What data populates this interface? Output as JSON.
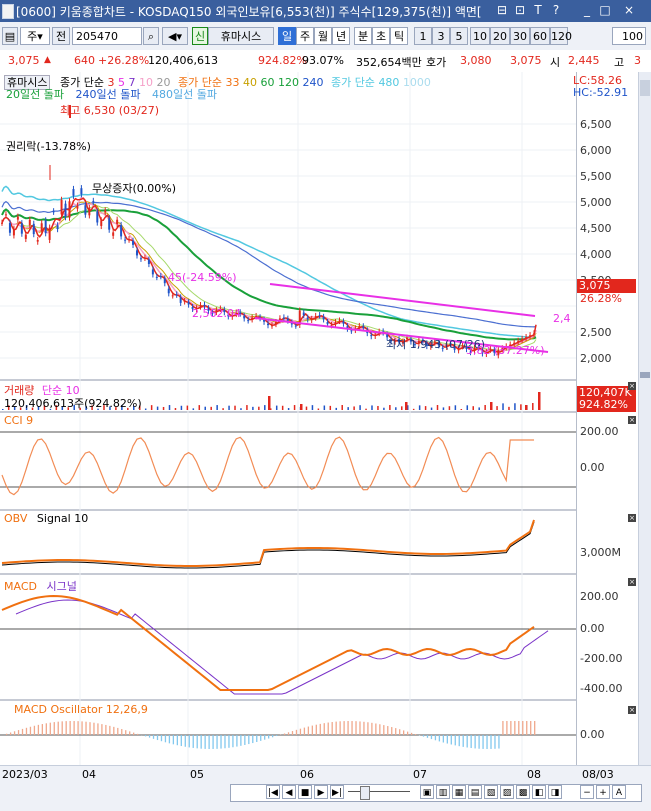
{
  "window": {
    "title": "[0600] 키움종합차트 - KOSDAQ150 외국인보유[6,553(천)] 주식수[129,375(천)] 액면[",
    "buttons": [
      "⊟",
      "⊡",
      "T",
      "?",
      "_",
      "□",
      "×"
    ]
  },
  "toolbar": {
    "period_select": "주",
    "jeon_label": "전",
    "code": "205470",
    "search_icon": "⌕",
    "sound_icon": "◀",
    "new_badge": "신",
    "company": "휴마시스",
    "intervals": [
      "일",
      "주",
      "월",
      "년",
      "분",
      "초",
      "틱"
    ],
    "active_interval": "일",
    "numbers": [
      "1",
      "3",
      "5",
      "10",
      "20",
      "30",
      "60",
      "120"
    ],
    "count": "100"
  },
  "info": {
    "price": "3,075",
    "change": "640",
    "pct": "+26.28%",
    "volume": "120,406,613",
    "vol_pct": "924.82%",
    "ratio": "93.07%",
    "amount": "352,654백만",
    "ho_label": "호가",
    "ask": "3,080",
    "bid": "3,075",
    "si_label": "시",
    "open": "2,445",
    "high_label": "고",
    "high": "3"
  },
  "price_panel": {
    "legend_name": "휴마시스",
    "ma_label": "종가 단순",
    "ma_short": [
      "3",
      "5",
      "7",
      "10",
      "20"
    ],
    "ma2_label": "종가 단순",
    "ma2_values": [
      "33",
      "40",
      "60",
      "120",
      "240"
    ],
    "ma3_label": "종가 단순",
    "ma3_values": [
      "480",
      "1000"
    ],
    "breakouts": [
      "20일선 돌파",
      "240일선 돌파",
      "480일선 돌파"
    ],
    "lc": "LC:58.26",
    "hc": "HC:-52.91",
    "max_label": "최고 6,530 (03/27)",
    "rights_label": "권리락(-13.78%)",
    "bonus_label": "무상증자(0.00%)",
    "min_label": "최저 1,943 (07/26)",
    "ann_a": "45(-24.59%)",
    "ann_b": "2,562.04",
    "ann_c": "2,4",
    "ann_d": "3,82 (37.27%)",
    "price_tag": "3,075",
    "pct_tag": "26.28%",
    "ticks": [
      "6,500",
      "6,000",
      "5,500",
      "5,000",
      "4,500",
      "4,000",
      "3,500",
      "2,500",
      "2,000"
    ]
  },
  "volume_panel": {
    "label": "거래량",
    "ma": "단순 10",
    "value": "120,406,613주(924.82%)",
    "tag": "120,407K",
    "tag2": "924.82%"
  },
  "cci_panel": {
    "label": "CCI 9",
    "ticks": [
      "200.00",
      "0.00"
    ]
  },
  "obv_panel": {
    "label": "OBV",
    "signal": "Signal 10",
    "tick": "3,000M"
  },
  "macd_panel": {
    "label": "MACD",
    "signal": "시그널",
    "ticks": [
      "200.00",
      "0.00",
      "-200.00",
      "-400.00"
    ]
  },
  "osc_panel": {
    "label": "MACD Oscillator 12,26,9",
    "tick": "0.00"
  },
  "dates": [
    "2023/03",
    "04",
    "05",
    "06",
    "07",
    "08",
    "08/03"
  ],
  "colors": {
    "up": "#e2271d",
    "down": "#1f54c9",
    "ma20": "#19a03a",
    "ma240": "#4b6fd1",
    "ma480": "#52c8e0",
    "trend": "#e830e6",
    "cci_fill": "#f28c55",
    "obv": "#f07010",
    "osc": "#f0a88c",
    "osc_neg": "#82c8ee"
  }
}
